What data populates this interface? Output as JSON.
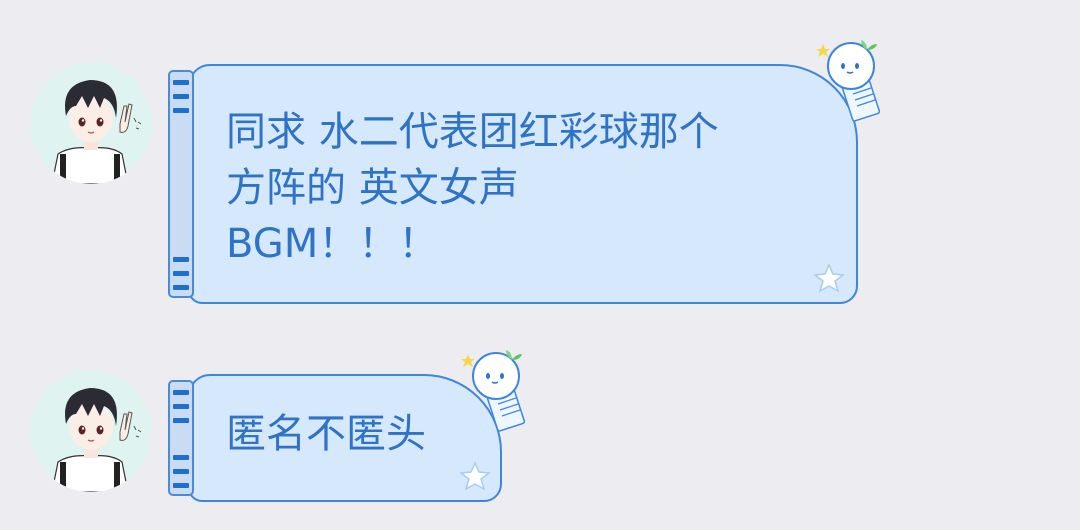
{
  "chat": {
    "messages": [
      {
        "text": "同求 水二代表团红彩球那个\n方阵的 英文女声\nBGM！！！",
        "sender_avatar": "boy-avatar",
        "bubble_theme": "blue-notebook-bubble"
      },
      {
        "text": "匿名不匿头",
        "sender_avatar": "boy-avatar",
        "bubble_theme": "blue-notebook-bubble"
      }
    ]
  },
  "theme": {
    "background": "#ececf1",
    "bubble_fill": "#d6e8fc",
    "bubble_border": "#3d86de",
    "text_color": "#2f73c7",
    "avatar_bg": "#dff3f0"
  },
  "icons": {
    "mascot": "sprout-mascot-icon",
    "star": "star-icon"
  }
}
